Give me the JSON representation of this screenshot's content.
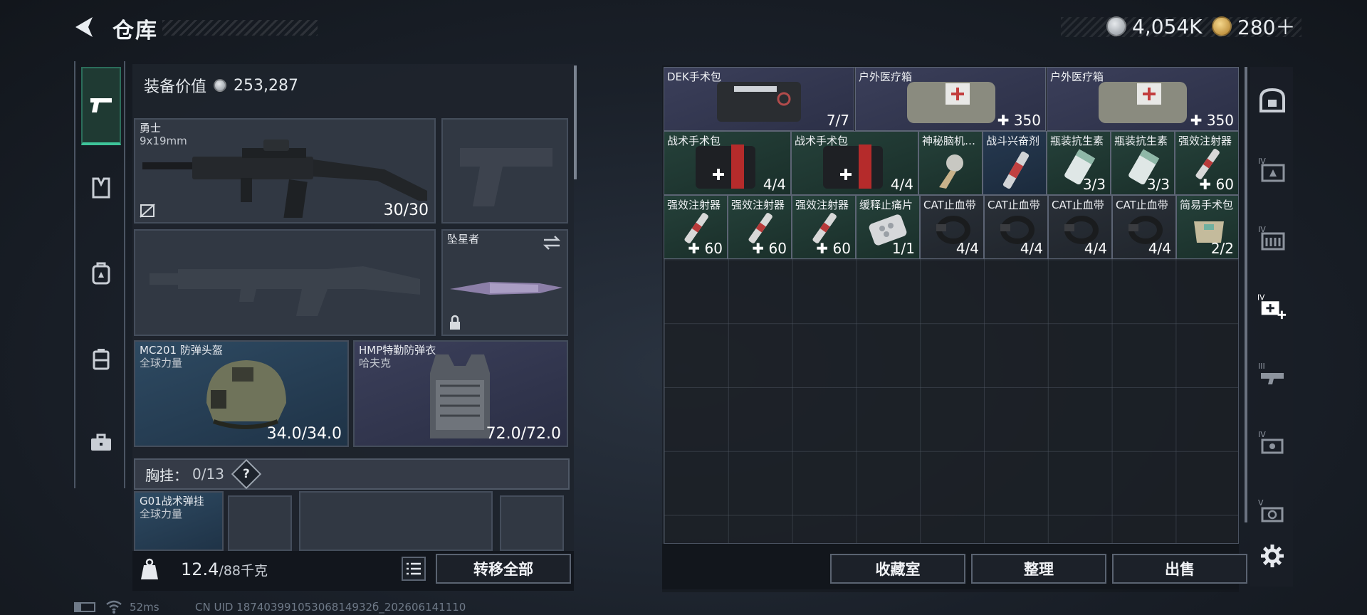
{
  "header": {
    "title": "仓库",
    "currency_silver": "4,054K",
    "currency_gold": "280＋"
  },
  "equipment": {
    "value_label": "装备价值",
    "value": "253,287",
    "primary": {
      "name": "勇士",
      "caliber": "9x19mm",
      "ammo": "30/30"
    },
    "melee": {
      "name": "坠星者"
    },
    "helmet": {
      "name": "MC201 防弹头盔",
      "brand": "全球力量",
      "durability": "34.0/34.0"
    },
    "armor": {
      "name": "HMP特勤防弹衣",
      "brand": "哈夫克",
      "durability": "72.0/72.0"
    },
    "chest_rig": {
      "label": "胸挂：",
      "capacity": "0/13",
      "help": "?",
      "name": "G01战术弹挂",
      "brand": "全球力量"
    }
  },
  "bottom": {
    "weight_current": "12.4",
    "weight_max": "/88千克",
    "transfer_all": "转移全部"
  },
  "storage": {
    "items": [
      {
        "name": "DEK手术包",
        "count": "7/7"
      },
      {
        "name": "户外医疗箱",
        "count": "✚ 350"
      },
      {
        "name": "户外医疗箱",
        "count": "✚ 350"
      },
      {
        "name": "战术手术包",
        "count": "4/4"
      },
      {
        "name": "战术手术包",
        "count": "4/4"
      },
      {
        "name": "神秘脑机…",
        "count": ""
      },
      {
        "name": "战斗兴奋剂",
        "count": ""
      },
      {
        "name": "瓶装抗生素",
        "count": "3/3"
      },
      {
        "name": "瓶装抗生素",
        "count": "3/3"
      },
      {
        "name": "强效注射器",
        "count": "✚ 60"
      },
      {
        "name": "强效注射器",
        "count": "✚ 60"
      },
      {
        "name": "强效注射器",
        "count": "✚ 60"
      },
      {
        "name": "强效注射器",
        "count": "✚ 60"
      },
      {
        "name": "缓释止痛片",
        "count": "1/1"
      },
      {
        "name": "CAT止血带",
        "count": "4/4"
      },
      {
        "name": "CAT止血带",
        "count": "4/4"
      },
      {
        "name": "CAT止血带",
        "count": "4/4"
      },
      {
        "name": "CAT止血带",
        "count": "4/4"
      },
      {
        "name": "简易手术包",
        "count": "2/2"
      }
    ],
    "buttons": {
      "collection": "收藏室",
      "organize": "整理",
      "sell": "出售"
    }
  },
  "status_bar": {
    "ping": "52ms",
    "uid": "CN UID 18740399105306814932б_202606141110"
  },
  "colors": {
    "accent_green": "#3ec49a",
    "coin_silver": "#b8bec6",
    "coin_gold": "#d9a84a"
  }
}
